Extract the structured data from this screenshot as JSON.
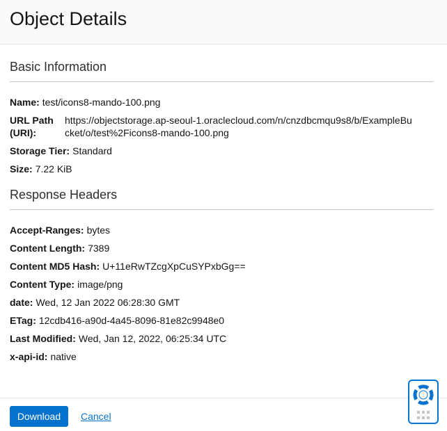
{
  "header": {
    "title": "Object Details"
  },
  "basic_information": {
    "title": "Basic Information",
    "name_label": "Name:",
    "name_value": "test/icons8-mando-100.png",
    "url_label": "URL Path (URI):",
    "url_value": "https://objectstorage.ap-seoul-1.oraclecloud.com/n/cnzdbcmqu9s8/b/ExampleBucket/o/test%2Ficons8-mando-100.png",
    "tier_label": "Storage Tier:",
    "tier_value": "Standard",
    "size_label": "Size:",
    "size_value": "7.22 KiB"
  },
  "response_headers": {
    "title": "Response Headers",
    "items": [
      {
        "label": "Accept-Ranges:",
        "value": "bytes"
      },
      {
        "label": "Content Length:",
        "value": "7389"
      },
      {
        "label": "Content MD5 Hash:",
        "value": "U+11eRwTZcgXpCuSYPxbGg=="
      },
      {
        "label": "Content Type:",
        "value": "image/png"
      },
      {
        "label": "date:",
        "value": "Wed, 12 Jan 2022 06:28:30 GMT"
      },
      {
        "label": "ETag:",
        "value": "12cdb416-a90d-4a45-8096-81e82c9948e0"
      },
      {
        "label": "Last Modified:",
        "value": "Wed, Jan 12, 2022, 06:25:34 UTC"
      },
      {
        "label": "x-api-id:",
        "value": "native"
      }
    ]
  },
  "footer": {
    "download_label": "Download",
    "cancel_label": "Cancel"
  },
  "colors": {
    "primary": "#0572ce",
    "text": "#161513",
    "divider": "#c5c5c5"
  },
  "icons": {
    "help": "lifebuoy-icon",
    "menu": "grid-dots-icon"
  }
}
